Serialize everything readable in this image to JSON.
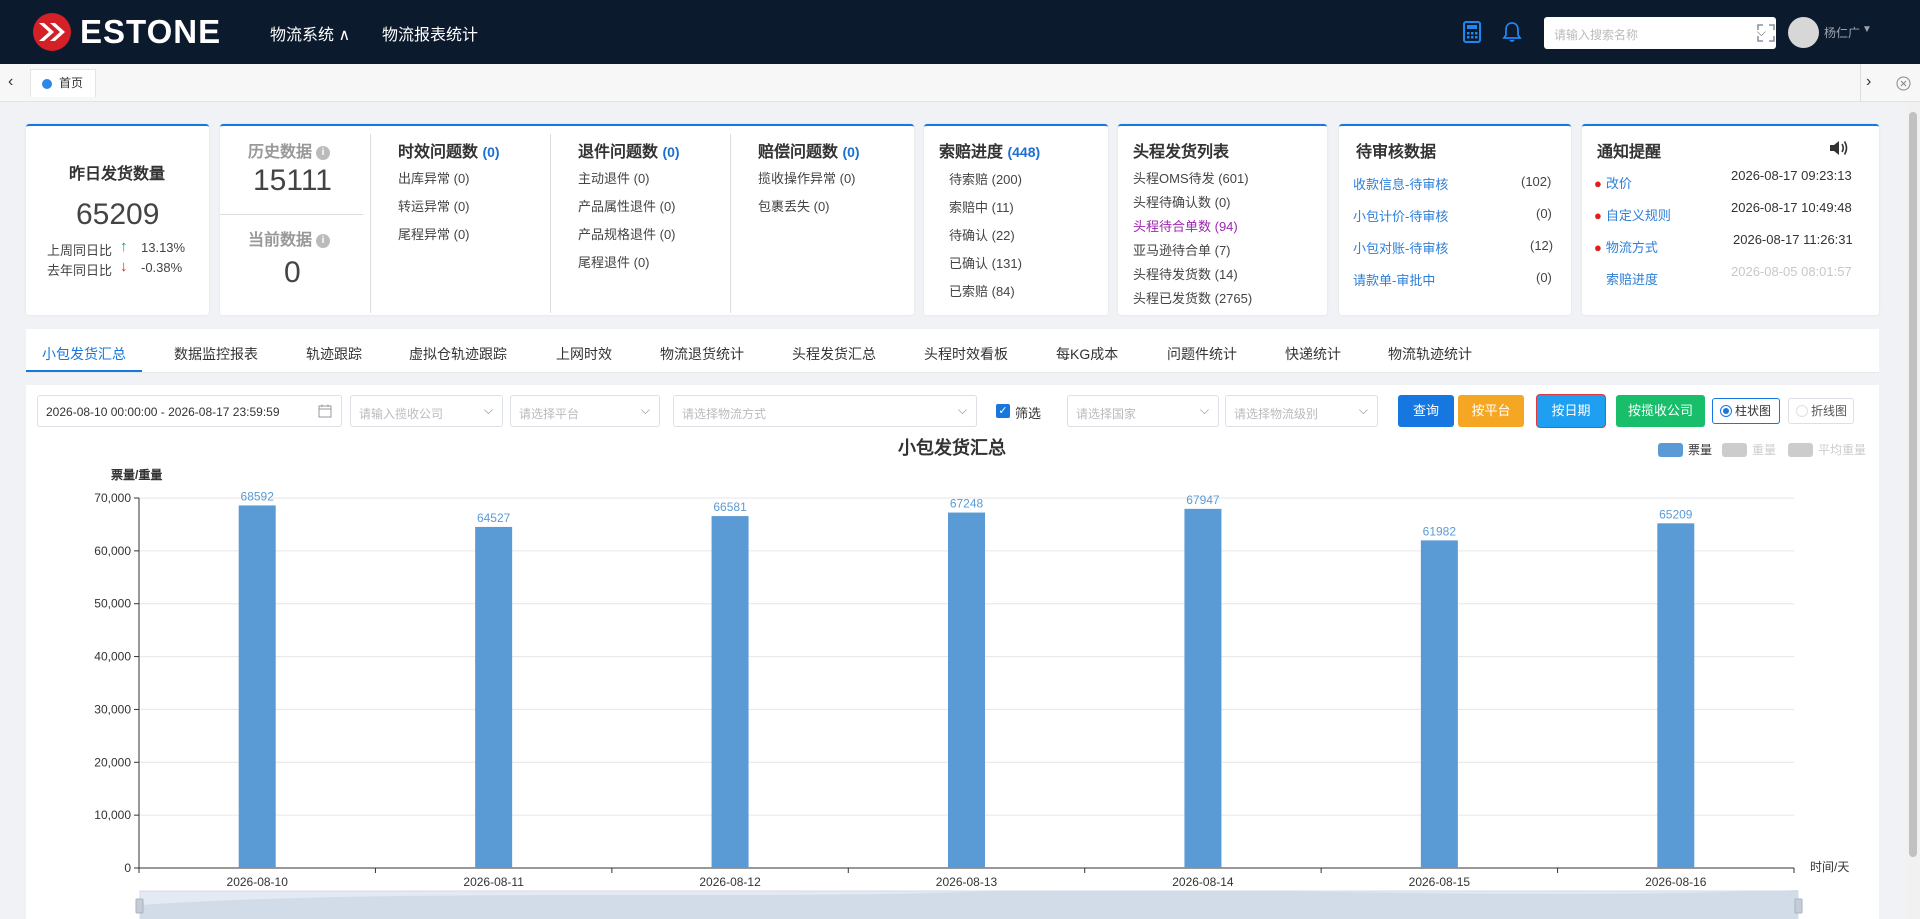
{
  "header": {
    "logo_text": "ESTONE",
    "nav": [
      "物流系统 ∧",
      "物流报表统计"
    ],
    "search_placeholder": "请输入搜索名称",
    "username": "杨仁广"
  },
  "tabs": {
    "home": "首页"
  },
  "cards": {
    "yesterday": {
      "title": "昨日发货数量",
      "value": "65209",
      "week_label": "上周同日比",
      "week_pct": "13.13%",
      "year_label": "去年同日比",
      "year_pct": "-0.38%"
    },
    "history": {
      "label": "历史数据",
      "value": "15111",
      "current_label": "当前数据",
      "current_value": "0"
    },
    "timeliness": {
      "title": "时效问题数",
      "count": "(0)",
      "items": [
        "出库异常 (0)",
        "转运异常 (0)",
        "尾程异常 (0)"
      ]
    },
    "returns": {
      "title": "退件问题数",
      "count": "(0)",
      "items": [
        "主动退件 (0)",
        "产品属性退件 (0)",
        "产品规格退件 (0)",
        "尾程退件 (0)"
      ]
    },
    "compensation": {
      "title": "赔偿问题数",
      "count": "(0)",
      "items": [
        "揽收操作异常 (0)",
        "包裹丢失 (0)"
      ]
    },
    "claims": {
      "title": "索赔进度",
      "count": "(448)",
      "items": [
        "待索赔   (200)",
        "索赔中   (11)",
        "待确认   (22)",
        "已确认   (131)",
        "已索赔   (84)"
      ]
    },
    "headship": {
      "title": "头程发货列表",
      "items": [
        "头程OMS待发   (601)",
        "头程待确认数   (0)",
        "头程待合单数   (94)",
        "亚马逊待合单   (7)",
        "头程待发货数   (14)",
        "头程已发货数   (2765)"
      ]
    },
    "review": {
      "title": "待审核数据",
      "items": [
        {
          "label": "收款信息-待审核",
          "count": "(102)"
        },
        {
          "label": "小包计价-待审核",
          "count": "(0)"
        },
        {
          "label": "小包对账-待审核",
          "count": "(12)"
        },
        {
          "label": "请款单-审批中",
          "count": "(0)"
        }
      ]
    },
    "notice": {
      "title": "通知提醒",
      "items": [
        {
          "label": "改价",
          "time": "2026-08-17 09:23:13"
        },
        {
          "label": "自定义规则",
          "time": "2026-08-17 10:49:48"
        },
        {
          "label": "物流方式",
          "time": "2026-08-17 11:26:31"
        },
        {
          "label": "索赔进度",
          "time": "2026-08-05 08:01:57"
        }
      ]
    }
  },
  "report_tabs": [
    "小包发货汇总",
    "数据监控报表",
    "轨迹跟踪",
    "虚拟仓轨迹跟踪",
    "上网时效",
    "物流退货统计",
    "头程发货汇总",
    "头程时效看板",
    "每KG成本",
    "问题件统计",
    "快递统计",
    "物流轨迹统计"
  ],
  "filters": {
    "date_range": "2026-08-10 00:00:00 - 2026-08-17 23:59:59",
    "company_placeholder": "请输入揽收公司",
    "platform_placeholder": "请选择平台",
    "method_placeholder": "请选择物流方式",
    "filter_label": "筛选",
    "country_placeholder": "请选择国家",
    "level_placeholder": "请选择物流级别",
    "buttons": {
      "query": "查询",
      "by_platform": "按平台",
      "by_date": "按日期",
      "by_company": "按揽收公司"
    },
    "view_bar": "柱状图",
    "view_line": "折线图",
    "colors": {
      "query": "#1677e0",
      "by_platform": "#f5a623",
      "by_date": "#1e9ff2",
      "by_company": "#19be6b"
    }
  },
  "chart_data": {
    "type": "bar",
    "title": "小包发货汇总",
    "ylabel": "票量/重量",
    "xlabel": "时间/天",
    "categories": [
      "2026-08-10",
      "2026-08-11",
      "2026-08-12",
      "2026-08-13",
      "2026-08-14",
      "2026-08-15",
      "2026-08-16"
    ],
    "series": [
      {
        "name": "票量",
        "values": [
          68592,
          64527,
          66581,
          67248,
          67947,
          61982,
          65209
        ],
        "active": true
      },
      {
        "name": "重量",
        "values": [],
        "active": false
      },
      {
        "name": "平均重量",
        "values": [],
        "active": false
      }
    ],
    "ylim": [
      0,
      70000
    ],
    "yticks": [
      "0",
      "10,000",
      "20,000",
      "30,000",
      "40,000",
      "50,000",
      "60,000",
      "70,000"
    ],
    "grid": true,
    "legend": "top-right",
    "color": "#5b9bd5"
  }
}
